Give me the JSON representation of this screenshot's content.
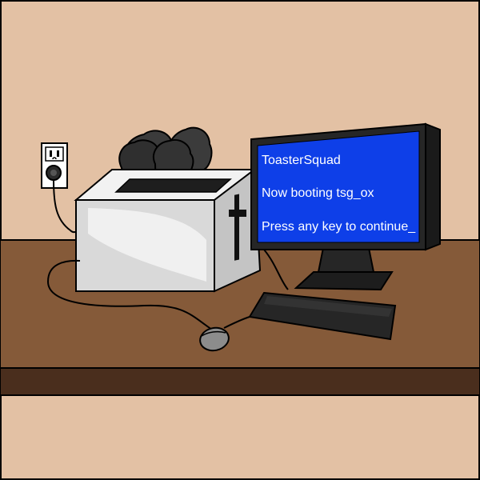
{
  "monitor": {
    "lines": [
      "ToasterSquad",
      "Now booting tsg_ox",
      "Press any key to continue_"
    ]
  },
  "colors": {
    "wall": "#e3c1a4",
    "desk_top": "#855a39",
    "desk_edge": "#4a2e1d",
    "screen": "#0e3fe8",
    "monitor_frame": "#262626",
    "toaster": "#d9d9d9",
    "toast": "#3b3b3b",
    "outline": "#000000"
  },
  "icons": {
    "outlet": "wall-outlet-icon",
    "mouse": "mouse-icon",
    "keyboard": "keyboard-icon"
  }
}
